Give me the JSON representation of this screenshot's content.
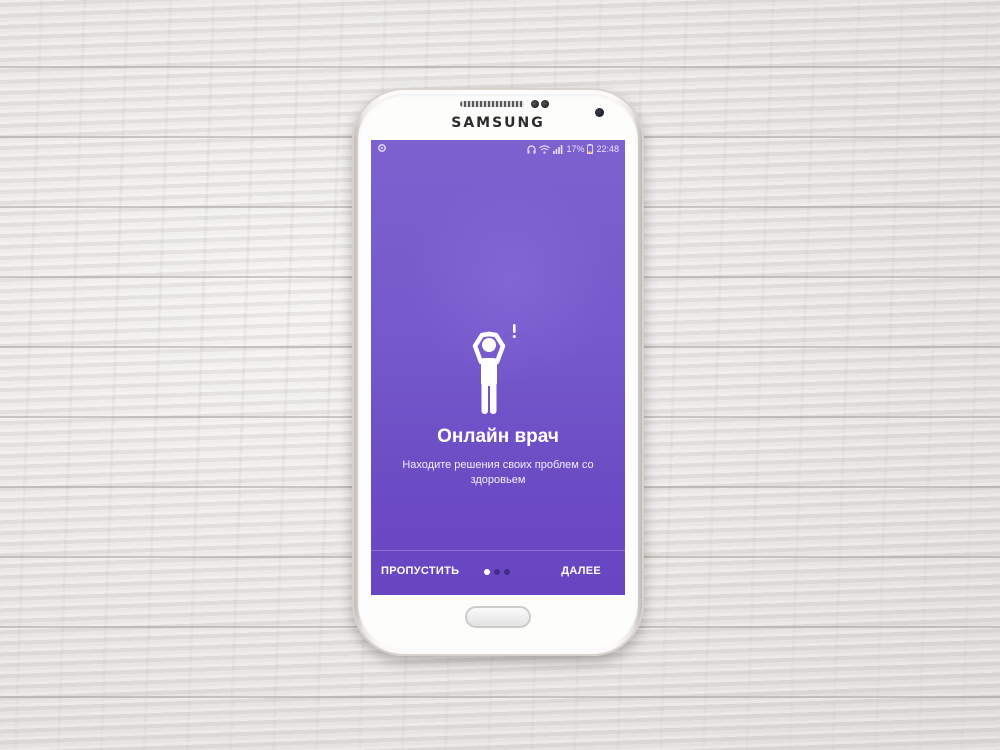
{
  "device": {
    "brand": "SAMSUNG"
  },
  "status_bar": {
    "battery": "17%",
    "time": "22:48",
    "icons": [
      "settings-icon",
      "headphones-icon",
      "wifi-icon",
      "signal-icon",
      "battery-icon"
    ]
  },
  "onboarding": {
    "title": "Онлайн врач",
    "subtitle": "Находите решения своих проблем со здоровьем",
    "illustration": "person-headache-icon",
    "page_count": 3,
    "current_page": 1
  },
  "nav": {
    "skip_label": "ПРОПУСТИТЬ",
    "next_label": "ДАЛЕЕ"
  },
  "colors": {
    "screen_top": "#7c61cf",
    "screen_bottom": "#6845c1",
    "text": "#ffffff"
  }
}
